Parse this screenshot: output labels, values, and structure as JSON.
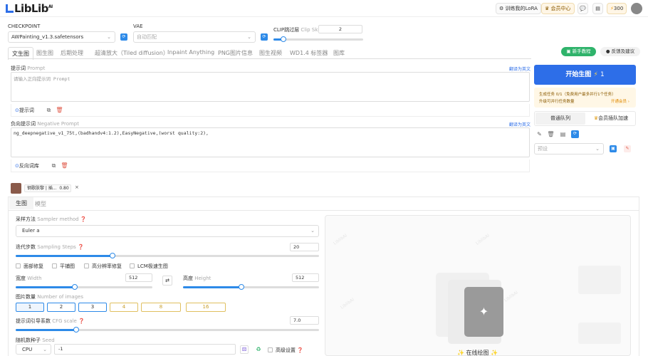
{
  "topbar": {
    "logo": "LibLib",
    "logo_sup": "AI",
    "train_lora": "训练我的LoRA",
    "member_center": "会员中心",
    "points": "300"
  },
  "model": {
    "checkpoint_label": "CHECKPOINT",
    "checkpoint_value": "AWPainting_v1.3.safetensors",
    "vae_label": "VAE",
    "vae_value": "自动匹配",
    "clip_label": "CLIP跳过层",
    "clip_sub": "Clip Skip",
    "clip_value": "2"
  },
  "tabs": [
    "文生图",
    "图生图",
    "后期处理",
    "超清放大（Tiled diffusion）",
    "Inpaint Anything",
    "PNG图片信息",
    "图生视频",
    "WD1.4 标签器",
    "图库"
  ],
  "header_buttons": {
    "tutorial": "新手教程",
    "feedback": "反馈及建议"
  },
  "prompt": {
    "label": "提示词",
    "sub": "Prompt",
    "translate": "翻译为英文",
    "placeholder": "请输入正向提示词 Prompt",
    "lib_button": "提示词"
  },
  "negative": {
    "label": "负向提示词",
    "sub": "Negative Prompt",
    "translate": "翻译为英文",
    "value": "ng_deepnegative_v1_75t,(badhandv4:1.2),EasyNegative,(worst quality:2),",
    "lib_button": "反向词库"
  },
  "lora": {
    "name": "钢歌肤黎 | 插...",
    "weight": "0.80"
  },
  "subtabs": [
    "生图",
    "模型"
  ],
  "sampler": {
    "label": "采样方法",
    "sub": "Sampler method",
    "value": "Euler a"
  },
  "steps": {
    "label": "迭代步数",
    "sub": "Sampling Steps",
    "value": "20",
    "fraction": 0.32
  },
  "checkboxes": [
    "面部修复",
    "平铺图",
    "高分辨率修复",
    "LCM极速生图"
  ],
  "width": {
    "label": "宽度",
    "sub": "Width",
    "value": "512",
    "fraction": 0.43
  },
  "height": {
    "label": "高度",
    "sub": "Height",
    "value": "512",
    "fraction": 0.43
  },
  "images": {
    "label": "图片数量",
    "sub": "Number of images",
    "options": [
      "1",
      "2",
      "3",
      "4",
      "8",
      "16"
    ]
  },
  "cfg": {
    "label": "提示词引导系数",
    "sub": "CFG scale",
    "value": "7.0",
    "fraction": 0.2
  },
  "seed": {
    "label": "随机数种子",
    "sub": "Seed",
    "device": "CPU",
    "value": "-1",
    "advanced": "高级设置"
  },
  "right": {
    "start_button": "开始生图",
    "start_count": "1",
    "task_info": "生成任务 0/1（免费用户最多并行1个任务）",
    "upgrade": "升级可并行任务数量",
    "open_member": "开通会员 ›",
    "queue_normal": "普通队列",
    "queue_vip": "会员插队加速",
    "preset_placeholder": "预设"
  },
  "canvas": {
    "online_draw": "在线绘图"
  },
  "colors": {
    "primary": "#2d8ae8",
    "green": "#2fb36b",
    "gold": "#e0c060"
  }
}
